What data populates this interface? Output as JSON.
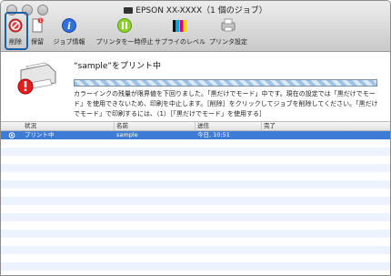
{
  "window": {
    "title": "EPSON XX-XXXX（1 個のジョブ）"
  },
  "toolbar": {
    "items": [
      {
        "label": "削除",
        "icon": "delete-icon"
      },
      {
        "label": "保留",
        "icon": "hold-document-icon"
      },
      {
        "label": "ジョブ情報",
        "icon": "info-icon"
      },
      {
        "label": "プリンタを一時停止",
        "icon": "pause-icon"
      },
      {
        "label": "サプライのレベル",
        "icon": "supply-levels-icon"
      },
      {
        "label": "プリンタ設定",
        "icon": "printer-settings-icon"
      }
    ],
    "badge": "1"
  },
  "status": {
    "headline": "“sample”をプリント中",
    "message": "カラーインクの残量が限界値を下回りました。「黒だけでモード」中です。現在の設定では「黒だけでモード」を使用できないため、印刷を中止します。［削除］をクリックしてジョブを削除してください。「黒だけでモード」で印刷するには、（1）［「黒だけでモード」を使用する］"
  },
  "table": {
    "columns": [
      "状況",
      "名前",
      "送信",
      "完了"
    ],
    "rows": [
      {
        "status": "プリント中",
        "name": "sample",
        "sent": "今日, 10:51",
        "done": ""
      }
    ]
  },
  "colors": {
    "selection": "#3d7bd7",
    "alt_row": "#edf3fe",
    "highlight_border": "#1f5fa6"
  }
}
